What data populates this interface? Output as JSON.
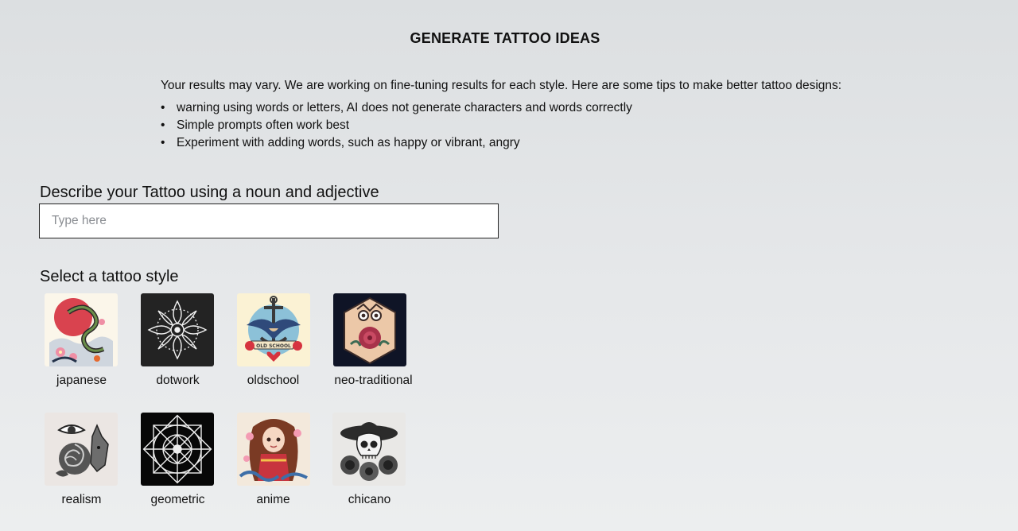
{
  "header": {
    "title": "GENERATE TATTOO IDEAS"
  },
  "tips": {
    "intro": "Your results may vary. We are working on fine-tuning results for each style. Here are some tips to make better tattoo designs:",
    "items": [
      "warning using words or letters, AI does not generate characters and words correctly",
      "Simple prompts often work best",
      "Experiment with adding words, such as happy or vibrant, angry"
    ]
  },
  "prompt": {
    "label": "Describe your Tattoo using a noun and adjective",
    "placeholder": "Type here",
    "value": ""
  },
  "styles": {
    "label": "Select a tattoo style",
    "items": [
      {
        "label": "japanese",
        "icon": "dragon-wave-image"
      },
      {
        "label": "dotwork",
        "icon": "mandala-image"
      },
      {
        "label": "oldschool",
        "icon": "swallow-anchor-image",
        "badge": "OLD SCHOOL"
      },
      {
        "label": "neo-traditional",
        "icon": "owl-rose-image"
      },
      {
        "label": "realism",
        "icon": "wolf-rose-eye-image"
      },
      {
        "label": "geometric",
        "icon": "geometric-mandala-image"
      },
      {
        "label": "anime",
        "icon": "anime-girl-image"
      },
      {
        "label": "chicano",
        "icon": "skull-sombrero-image"
      }
    ]
  }
}
